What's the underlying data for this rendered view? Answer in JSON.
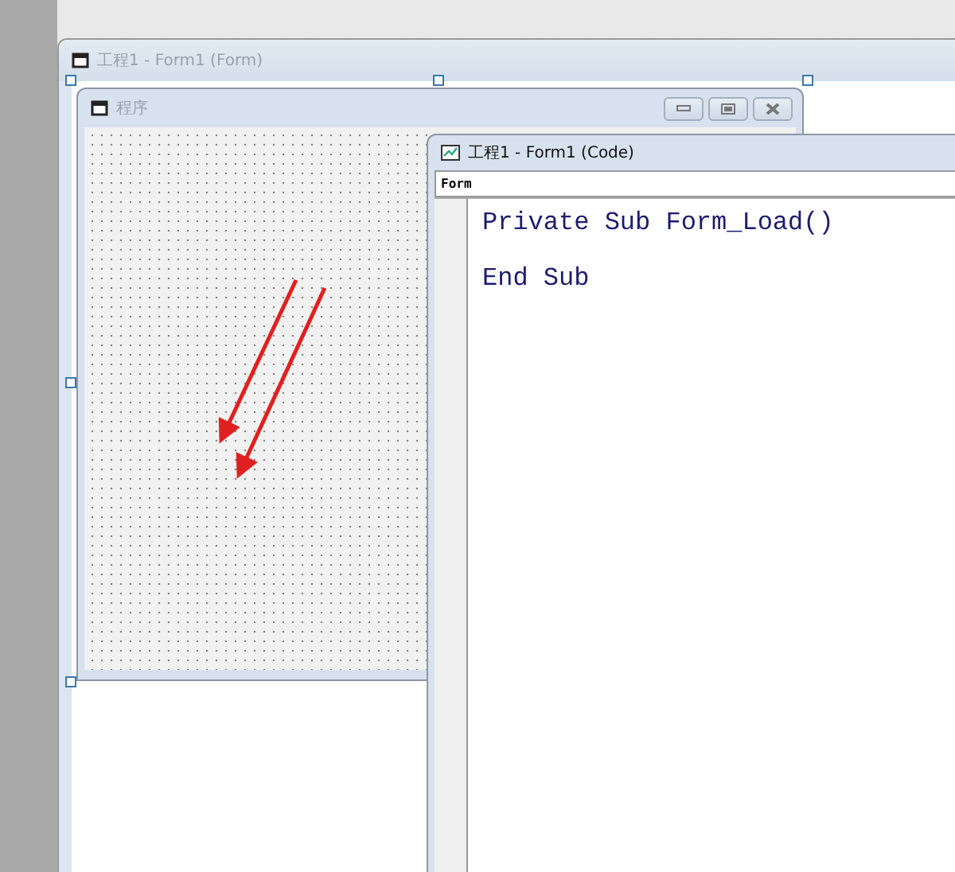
{
  "form_designer": {
    "title": "工程1 - Form1 (Form)"
  },
  "form": {
    "title": "程序",
    "buttons": [
      {
        "kind": "minimize"
      },
      {
        "kind": "maximize"
      },
      {
        "kind": "close"
      }
    ]
  },
  "code_window": {
    "title": "工程1 - Form1 (Code)",
    "object_box": "Form",
    "lines": [
      "Private Sub Form_Load()",
      "End Sub"
    ]
  },
  "annotations": [
    {
      "kind": "arrow"
    },
    {
      "kind": "arrow"
    }
  ]
}
